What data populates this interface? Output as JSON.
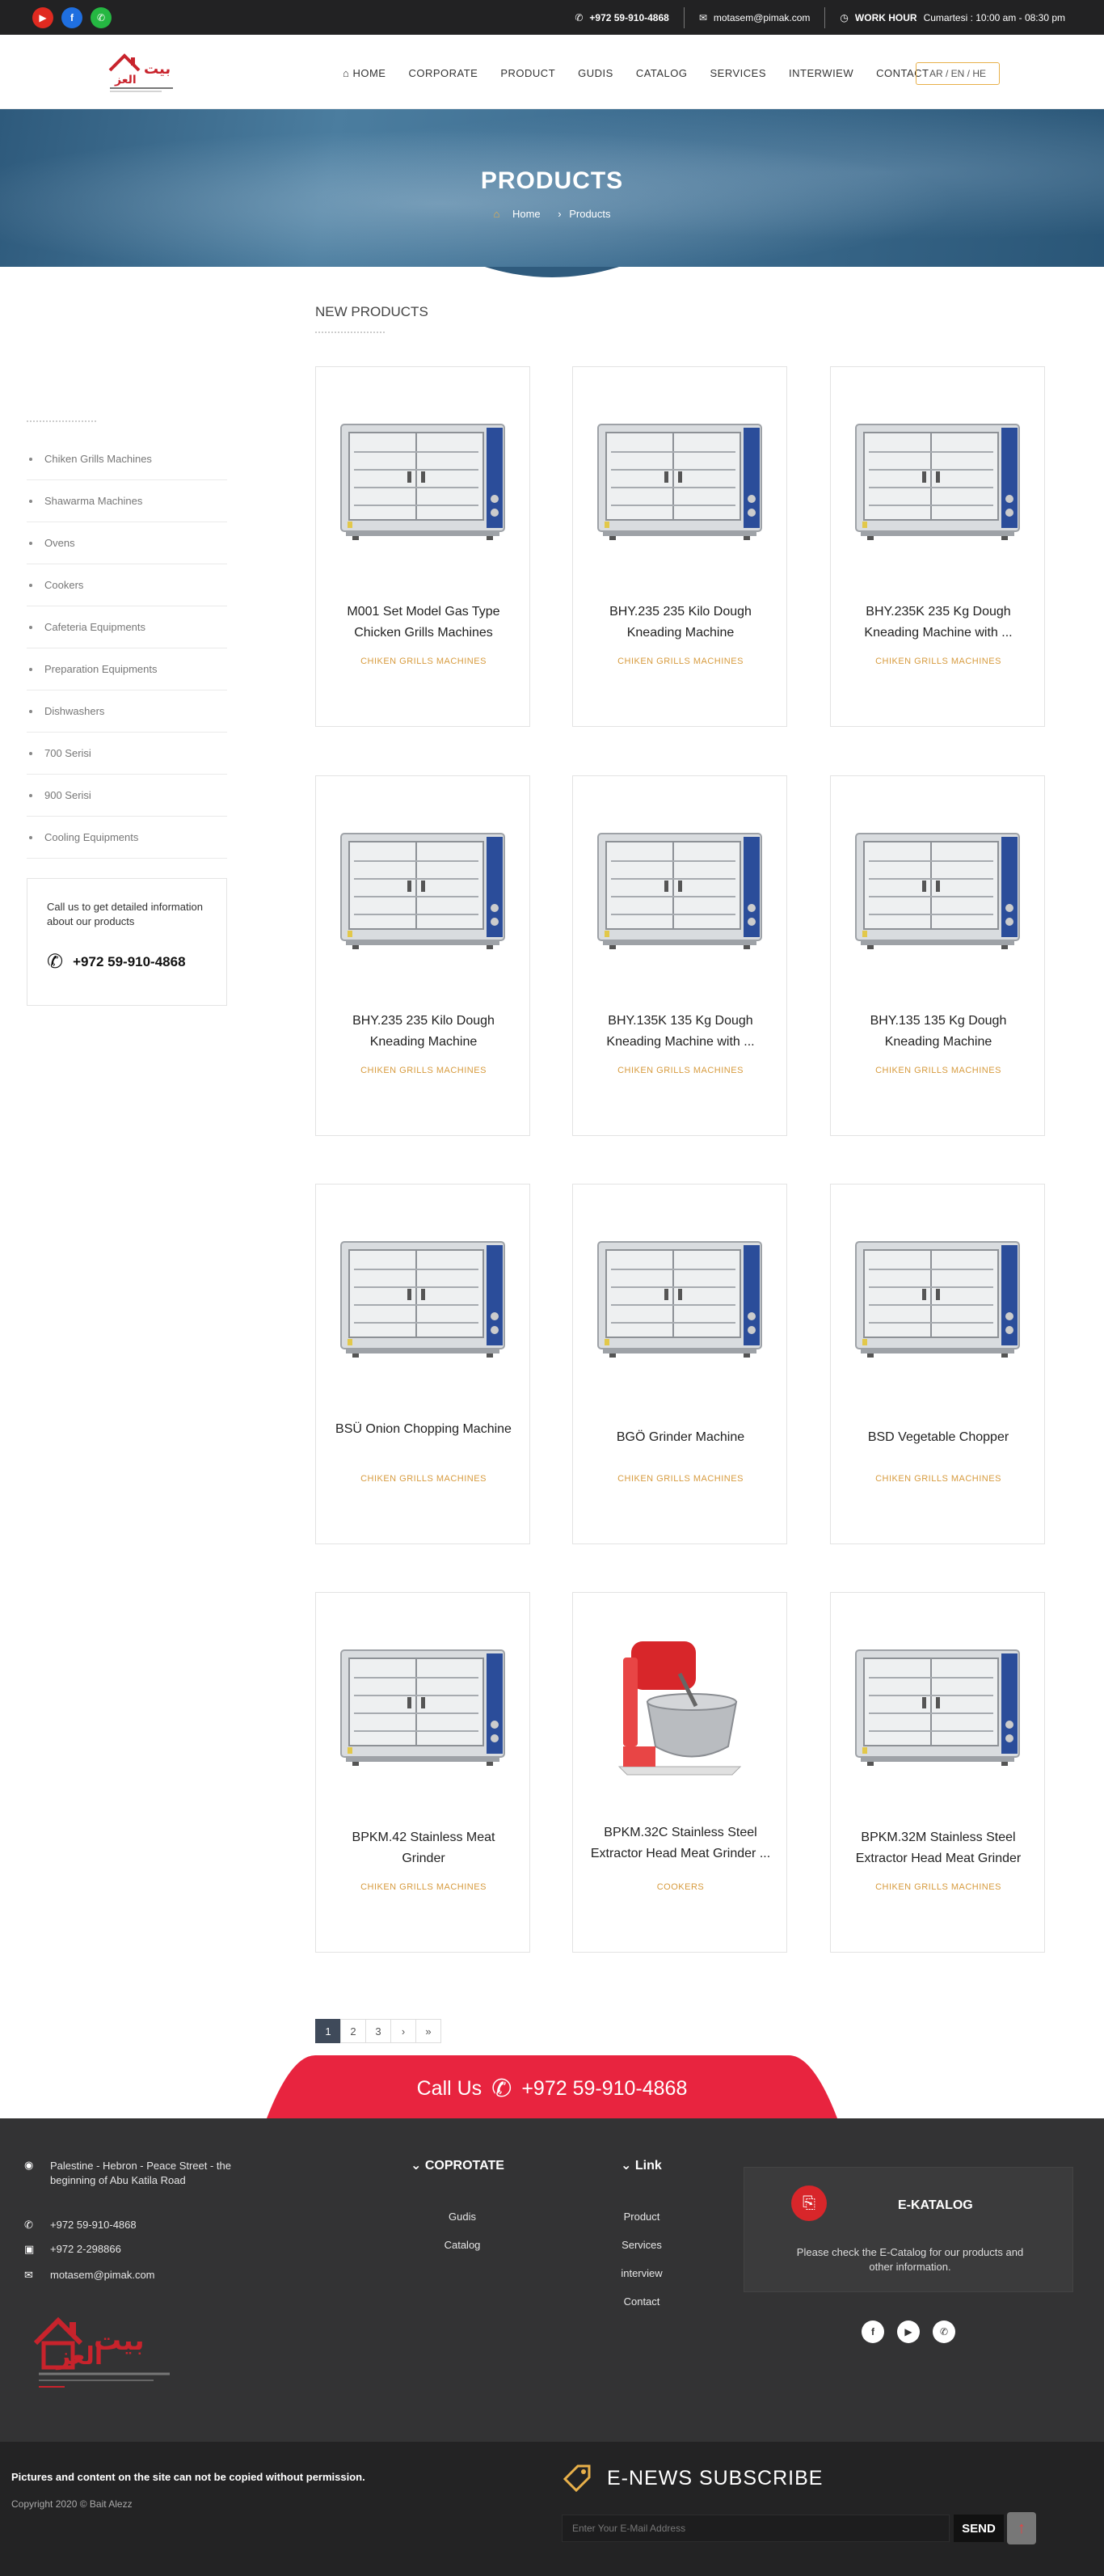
{
  "header": {
    "phone": "+972 59-910-4868",
    "email": "motasem@pimak.com",
    "work_hour_label": "WORK HOUR",
    "work_hour_value": "Cumartesi : 10:00 am - 08:30 pm",
    "social_icons": [
      "youtube-icon",
      "facebook-icon",
      "whatsapp-icon"
    ]
  },
  "nav": {
    "items": [
      "HOME",
      "CORPORATE",
      "PRODUCT",
      "GUDIS",
      "CATALOG",
      "SERVICES",
      "INTERWIEW",
      "CONTACT"
    ],
    "lang": "AR / EN / HE"
  },
  "banner": {
    "title": "PRODUCTS",
    "crumb_home": "Home",
    "crumb_current": "Products"
  },
  "sidebar": {
    "categories": [
      "Chiken Grills Machines",
      "Shawarma Machines",
      "Ovens",
      "Cookers",
      "Cafeteria Equipments",
      "Preparation Equipments",
      "Dishwashers",
      "700 Serisi",
      "900 Serisi",
      "Cooling Equipments"
    ],
    "call_text": "Call us to get detailed information about our products",
    "call_phone": "+972 59-910-4868"
  },
  "main": {
    "heading": "NEW PRODUCTS",
    "products": [
      {
        "title": "M001 Set Model Gas Type Chicken Grills Machines",
        "category": "CHIKEN GRILLS MACHINES",
        "image": "rotisserie"
      },
      {
        "title": "BHY.235 235 Kilo Dough Kneading Machine",
        "category": "CHIKEN GRILLS MACHINES",
        "image": "rotisserie"
      },
      {
        "title": "BHY.235K 235 Kg Dough Kneading Machine with ...",
        "category": "CHIKEN GRILLS MACHINES",
        "image": "rotisserie"
      },
      {
        "title": "BHY.235 235 Kilo Dough Kneading Machine",
        "category": "CHIKEN GRILLS MACHINES",
        "image": "rotisserie"
      },
      {
        "title": "BHY.135K 135 Kg Dough Kneading Machine with ...",
        "category": "CHIKEN GRILLS MACHINES",
        "image": "rotisserie"
      },
      {
        "title": "BHY.135 135 Kg Dough Kneading Machine",
        "category": "CHIKEN GRILLS MACHINES",
        "image": "rotisserie"
      },
      {
        "title": "BSÜ Onion Chopping Machine",
        "category": "CHIKEN GRILLS MACHINES",
        "image": "rotisserie"
      },
      {
        "title": "BGÖ Grinder Machine",
        "category": "CHIKEN GRILLS MACHINES",
        "image": "rotisserie"
      },
      {
        "title": "BSD Vegetable Chopper",
        "category": "CHIKEN GRILLS MACHINES",
        "image": "rotisserie"
      },
      {
        "title": "BPKM.42 Stainless Meat Grinder",
        "category": "CHIKEN GRILLS MACHINES",
        "image": "rotisserie"
      },
      {
        "title": "BPKM.32C Stainless Steel Extractor Head Meat Grinder ...",
        "category": "COOKERS",
        "image": "mixer"
      },
      {
        "title": "BPKM.32M Stainless Steel Extractor Head Meat Grinder",
        "category": "CHIKEN GRILLS MACHINES",
        "image": "rotisserie"
      }
    ],
    "pagination": [
      "1",
      "2",
      "3",
      "›",
      "»"
    ],
    "current_page": "1"
  },
  "ribbon": {
    "label": "Call Us",
    "phone": "+972 59-910-4868"
  },
  "footer": {
    "address": "Palestine - Hebron - Peace Street - the beginning of Abu Katila Road",
    "phone1": "+972 59-910-4868",
    "phone2": "+972 2-298866",
    "email": "motasem@pimak.com",
    "col2_title": "COPROTATE",
    "col2_links": [
      "Gudis",
      "Catalog"
    ],
    "col3_title": "Link",
    "col3_links": [
      "Product",
      "Services",
      "interview",
      "Contact"
    ],
    "ekatalog_title": "E-KATALOG",
    "ekatalog_desc": "Please check the E-Catalog for our products and other information.",
    "social_icons": [
      "facebook-icon",
      "youtube-icon",
      "whatsapp-icon"
    ]
  },
  "bottom": {
    "notice": "Pictures and content on the site can not be copied without permission.",
    "copyright": "Copyright 2020 © Bait Alezz",
    "enews_title": "E-NEWS SUBSCRIBE",
    "email_placeholder": "Enter Your E-Mail Address",
    "send_label": "SEND"
  },
  "colors": {
    "accent_red": "#e8243f",
    "category_gold": "#d79b3e",
    "banner_blue": "#3f6f92",
    "footer_bg": "#333334"
  }
}
